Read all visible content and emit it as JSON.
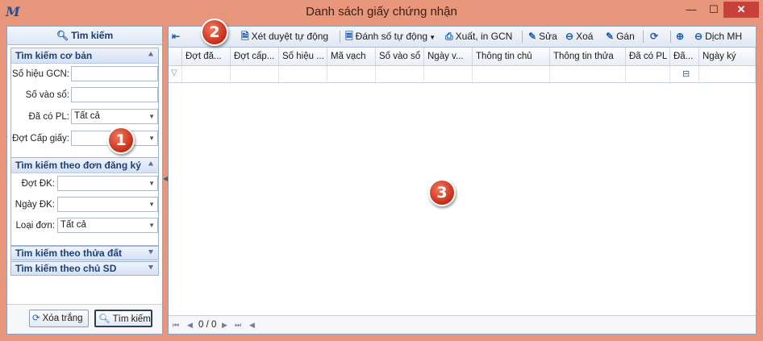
{
  "window": {
    "title": "Danh sách giấy chứng nhận",
    "minimize": "—",
    "maximize": "☐",
    "close": "✕",
    "app_icon": "M"
  },
  "left_panel": {
    "header": "Tìm kiếm",
    "basic": {
      "title": "Tìm kiếm cơ bản",
      "fields": [
        {
          "label": "Số hiệu GCN:",
          "value": ""
        },
        {
          "label": "Số vào sổ:",
          "value": ""
        },
        {
          "label": "Đã có PL:",
          "value": "Tất cả"
        },
        {
          "label": "Đợt Cấp giấy:",
          "value": ""
        }
      ]
    },
    "by_application": {
      "title": "Tìm kiếm theo đơn đăng ký",
      "fields": [
        {
          "label": "Đợt ĐK:",
          "value": ""
        },
        {
          "label": "Ngày ĐK:",
          "value": ""
        },
        {
          "label": "Loại đơn:",
          "value": "Tất cả"
        }
      ]
    },
    "by_parcel": {
      "title": "Tìm kiếm theo thửa đất"
    },
    "by_owner": {
      "title": "Tìm kiếm theo chủ SD"
    },
    "buttons": {
      "clear": "Xóa trắng",
      "search": "Tìm kiếm"
    }
  },
  "toolbar": {
    "approve": "Xét duyệt tự động",
    "auto_number": "Đánh số tự động",
    "export_print": "Xuất, in GCN",
    "edit": "Sửa",
    "delete": "Xoá",
    "assign": "Gán",
    "translate": "Dịch MH"
  },
  "grid": {
    "columns": [
      "Đợt đă...",
      "Đợt cấp...",
      "Số hiệu ...",
      "Mã vạch",
      "Số vào sổ",
      "Ngày v...",
      "Thông tin chủ",
      "Thông tin thửa",
      "Đã có PL",
      "Đã...",
      "Ngày ký"
    ]
  },
  "status": {
    "page_info": "0 / 0"
  },
  "annotations": [
    "1",
    "2",
    "3"
  ],
  "colors": {
    "window_frame": "#e8967b",
    "accent": "#1f5fb5",
    "close_button": "#c7413a",
    "badge": "#c9321d"
  }
}
